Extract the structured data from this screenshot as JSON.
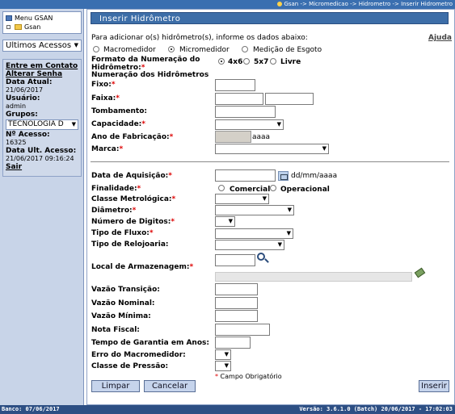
{
  "breadcrumb": "Gsan -> Micromedicao -> Hidrometro -> Inserir Hidrometro",
  "sidebar": {
    "menu_root": "Menu GSAN",
    "menu_folder": "Gsan",
    "recent_select": "Ultimos Acessos",
    "link_contact": "Entre em Contato",
    "link_password": "Alterar Senha",
    "date_label": "Data Atual:",
    "date_value": "21/06/2017",
    "user_label": "Usuário:",
    "user_value": "admin",
    "groups_label": "Grupos:",
    "groups_value": "TECNOLOGIA D",
    "access_no_label": "Nº Acesso:",
    "access_no_value": "16325",
    "last_access_label": "Data Ult. Acesso:",
    "last_access_value": "21/06/2017 09:16:24",
    "logout": "Sair"
  },
  "form": {
    "title": "Inserir Hidrômetro",
    "intro": "Para adicionar o(s) hidrômetro(s), informe os dados abaixo:",
    "help": "Ajuda",
    "type_options": [
      "Macromedidor",
      "Micromedidor",
      "Medição de Esgoto"
    ],
    "type_selected": "Micromedidor",
    "numbering_format_label": "Formato da Numeração do Hidrômetro:",
    "numbering_format_options": [
      "4x6",
      "5x7",
      "Livre"
    ],
    "numbering_format_selected": "4x6",
    "numbering_section": "Numeração dos Hidrômetros",
    "fixed_label": "Fixo:",
    "range_label": "Faixa:",
    "tombamento_label": "Tombamento:",
    "capacity_label": "Capacidade:",
    "year_label": "Ano de Fabricação:",
    "year_hint": "aaaa",
    "brand_label": "Marca:",
    "acquisition_label": "Data de Aquisição:",
    "acquisition_hint": "dd/mm/aaaa",
    "purpose_label": "Finalidade:",
    "purpose_options": [
      "Comercial",
      "Operacional"
    ],
    "metrological_label": "Classe Metrológica:",
    "diameter_label": "Diâmetro:",
    "digits_label": "Número de Digitos:",
    "flow_type_label": "Tipo de Fluxo:",
    "clock_type_label": "Tipo de Relojoaria:",
    "storage_label": "Local de Armazenagem:",
    "transition_flow_label": "Vazão Transição:",
    "nominal_flow_label": "Vazão Nominal:",
    "min_flow_label": "Vazão Mínima:",
    "invoice_label": "Nota Fiscal:",
    "warranty_label": "Tempo de Garantia em Anos:",
    "macro_error_label": "Erro do Macromedidor:",
    "pressure_class_label": "Classe de Pressão:",
    "required_note": "Campo Obrigatório",
    "buttons": {
      "clear": "Limpar",
      "cancel": "Cancelar",
      "insert": "Inserir"
    }
  },
  "footer": {
    "db": "Banco: 07/06/2017",
    "version": "Versão: 3.6.1.0 (Batch) 20/06/2017 - 17:02:03"
  }
}
